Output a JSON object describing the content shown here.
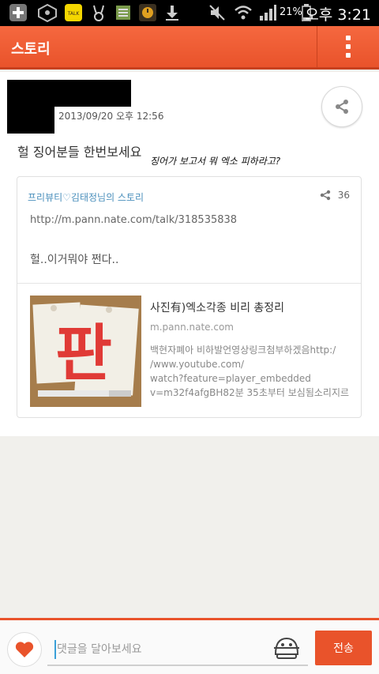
{
  "status_bar": {
    "battery": "21%",
    "time": "오후 3:21",
    "icons": [
      "add-icon",
      "exo-icon",
      "kakaotalk-icon",
      "bunny-icon",
      "notes-icon",
      "clock-app-icon",
      "download-icon",
      "mute-icon",
      "wifi-icon",
      "signal-icon",
      "battery-icon"
    ]
  },
  "header": {
    "title": "스토리",
    "menu_icon": "more-vert-icon"
  },
  "post": {
    "timestamp": "2013/09/20 오후 12:56",
    "text": "헐 징어분들 한번보세요",
    "annotation": "징어가 보고서 뭐 엑소 피하라고?"
  },
  "shared_card": {
    "author": "프리뷰티♡김태정님의 스토리",
    "share_count": "36",
    "url": "http://m.pann.nate.com/talk/318535838",
    "body": "헐..이거뭐야 쩐다..",
    "link": {
      "title": "사진有)엑소각종 비리 총정리",
      "domain": "m.pann.nate.com",
      "description_lines": [
        "백현자폐아 비하발언영상링크첨부하겠음http:/",
        "/www.youtube.com/",
        "watch?feature=player_embedded",
        "v=m32f4afgBH82분 35초부터 보심됨소리지르"
      ],
      "thumb_text": "판"
    }
  },
  "bottom_bar": {
    "comment_placeholder": "댓글을 달아보세요",
    "send_label": "전송"
  },
  "colors": {
    "accent": "#e9532b",
    "link_blue": "#4a8fbc"
  }
}
